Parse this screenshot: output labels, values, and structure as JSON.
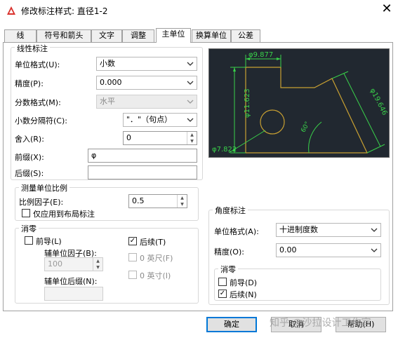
{
  "window": {
    "title": "修改标注样式: 直径1-2",
    "close_glyph": "✕"
  },
  "tabs": [
    {
      "label": "线"
    },
    {
      "label": "符号和箭头"
    },
    {
      "label": "文字"
    },
    {
      "label": "调整"
    },
    {
      "label": "主单位",
      "active": true
    },
    {
      "label": "换算单位"
    },
    {
      "label": "公差"
    }
  ],
  "linear": {
    "legend": "线性标注",
    "unit_format": {
      "label": "单位格式(U):",
      "value": "小数"
    },
    "precision": {
      "label": "精度(P):",
      "value": "0.000"
    },
    "fraction_format": {
      "label": "分数格式(M):",
      "value": "水平"
    },
    "decimal_separator": {
      "label": "小数分隔符(C):",
      "value": "\"．\"（句点）"
    },
    "round_off": {
      "label": "舍入(R):",
      "value": "0"
    },
    "prefix": {
      "label": "前缀(X):",
      "value": "φ"
    },
    "suffix": {
      "label": "后缀(S):",
      "value": ""
    }
  },
  "measurement_scale": {
    "legend": "测量单位比例",
    "scale_factor": {
      "label": "比例因子(E):",
      "value": "0.5"
    },
    "layout_only": {
      "label": "仅应用到布局标注",
      "checked": false
    }
  },
  "zero_suppression": {
    "legend": "消零",
    "leading": {
      "label": "前导(L)",
      "checked": false
    },
    "trailing": {
      "label": "后续(T)",
      "checked": true
    },
    "sub_unit_factor": {
      "label": "辅单位因子(B):",
      "value": "100"
    },
    "sub_unit_suffix": {
      "label": "辅单位后缀(N):",
      "value": ""
    },
    "feet": {
      "label": "0 英尺(F)",
      "checked": false
    },
    "inches": {
      "label": "0 英寸(I)",
      "checked": false
    }
  },
  "angular": {
    "legend": "角度标注",
    "unit_format": {
      "label": "单位格式(A):",
      "value": "十进制度数"
    },
    "precision": {
      "label": "精度(O):",
      "value": "0.00"
    },
    "zero_suppression": {
      "legend": "消零",
      "leading": {
        "label": "前导(D)",
        "checked": false
      },
      "trailing": {
        "label": "后续(N)",
        "checked": true
      }
    }
  },
  "preview": {
    "dim_top": "φ9.877",
    "dim_left": "φ11.623",
    "dim_bottom": "φ7.822",
    "dim_right": "φ19.646",
    "dim_angle": "60°",
    "colors": {
      "background": "#212830",
      "geometry": "#c8a032",
      "dimensions": "#39d14a",
      "text": "#ffffff"
    }
  },
  "buttons": {
    "ok": "确定",
    "cancel": "取消",
    "help": "帮助(H)"
  },
  "watermark": "知乎 @沙拉设计工作室",
  "colors": {
    "accent": "#0078d7",
    "title_icon": "#d9302b"
  }
}
